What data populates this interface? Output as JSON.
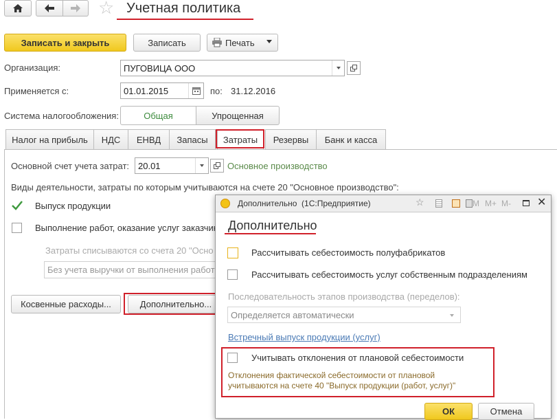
{
  "window": {
    "title": "Учетная политика"
  },
  "toolbar": {
    "save_close": "Записать и закрыть",
    "save": "Записать",
    "print": "Печать"
  },
  "org": {
    "label": "Организация:",
    "value": "ПУГОВИЦА ООО"
  },
  "applies": {
    "label": "Применяется с:",
    "from": "01.01.2015",
    "to_label": "по:",
    "to": "31.12.2016"
  },
  "tax_system": {
    "label": "Система налогообложения:",
    "options": [
      "Общая",
      "Упрощенная"
    ],
    "selected": "Общая"
  },
  "tabs": [
    "Налог на прибыль",
    "НДС",
    "ЕНВД",
    "Запасы",
    "Затраты",
    "Резервы",
    "Банк и касса"
  ],
  "active_tab": "Затраты",
  "costs": {
    "account_label": "Основной счет учета затрат:",
    "account_value": "20.01",
    "account_link": "Основное производство",
    "activities_label": "Виды деятельности, затраты по которым учитываются на счете 20 \"Основное производство\":",
    "output_label": "Выпуск продукции",
    "output_checked": true,
    "services_label": "Выполнение работ, оказание услуг заказчик",
    "services_checked": false,
    "writeoff_label": "Затраты списываются со счета 20 \"Осно",
    "writeoff_value": "Без учета выручки от выполнения работ",
    "indirect_btn": "Косвенные расходы...",
    "additional_btn": "Дополнительно..."
  },
  "dialog": {
    "title": "Дополнительно  (1С:Предприятие)",
    "heading": "Дополнительно",
    "title_buttons": [
      "M",
      "M+",
      "M-"
    ],
    "semi_label": "Рассчитывать себестоимость полуфабрикатов",
    "semi_checked": false,
    "own_services_label": "Рассчитывать себестоимость услуг собственным подразделениям",
    "own_services_checked": false,
    "sequence_label": "Последовательность этапов производства (переделов):",
    "sequence_value": "Определяется автоматически",
    "counter_link": "Встречный выпуск продукции (услуг)",
    "deviation_label": "Учитывать отклонения от плановой себестоимости",
    "deviation_checked": false,
    "deviation_note_1": "Отклонения фактической себестоимости от плановой",
    "deviation_note_2": "учитываются на счете 40 \"Выпуск продукции (работ, услуг)\"",
    "ok": "ОК",
    "cancel": "Отмена"
  },
  "colors": {
    "accent_yellow": "#f5d43c",
    "highlight_red": "#d0202a",
    "link": "#4a7ab5",
    "green_text": "#5a8a4a"
  }
}
